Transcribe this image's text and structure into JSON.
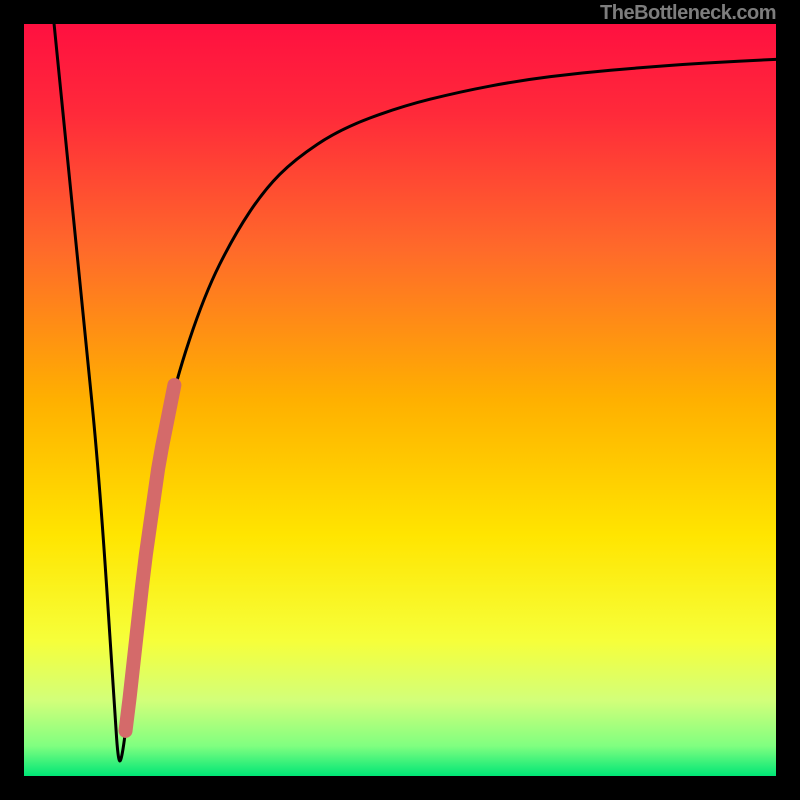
{
  "watermark": "TheBottleneck.com",
  "colors": {
    "frame": "#000000",
    "curve": "#000000",
    "overlay_segment": "#d46a6a",
    "gradient_stops": [
      {
        "offset": 0.0,
        "color": "#ff1040"
      },
      {
        "offset": 0.12,
        "color": "#ff2a3a"
      },
      {
        "offset": 0.3,
        "color": "#ff6a2a"
      },
      {
        "offset": 0.5,
        "color": "#ffb000"
      },
      {
        "offset": 0.68,
        "color": "#ffe500"
      },
      {
        "offset": 0.82,
        "color": "#f6ff3a"
      },
      {
        "offset": 0.9,
        "color": "#d2ff7a"
      },
      {
        "offset": 0.96,
        "color": "#80ff80"
      },
      {
        "offset": 1.0,
        "color": "#00e676"
      }
    ]
  },
  "chart_data": {
    "type": "line",
    "title": "",
    "xlabel": "",
    "ylabel": "",
    "xlim": [
      0,
      100
    ],
    "ylim": [
      0,
      100
    ],
    "grid": false,
    "series": [
      {
        "name": "bottleneck-curve",
        "x": [
          4,
          6,
          8,
          10,
          12,
          12.5,
          13,
          14,
          16,
          18,
          20,
          24,
          28,
          32,
          36,
          42,
          50,
          58,
          66,
          74,
          82,
          90,
          100
        ],
        "y": [
          100,
          80,
          60,
          40,
          10,
          2,
          2,
          10,
          28,
          42,
          52,
          64,
          72,
          78,
          82,
          86,
          89,
          91,
          92.5,
          93.5,
          94.2,
          94.8,
          95.3
        ]
      }
    ],
    "overlay_segment": {
      "name": "highlighted-range",
      "x_from": 13.5,
      "x_to": 20,
      "stroke_width_px": 14,
      "note": "thick reddish segment sitting on the rising branch just after the minimum"
    },
    "minimum": {
      "x": 12.8,
      "y": 2
    }
  }
}
